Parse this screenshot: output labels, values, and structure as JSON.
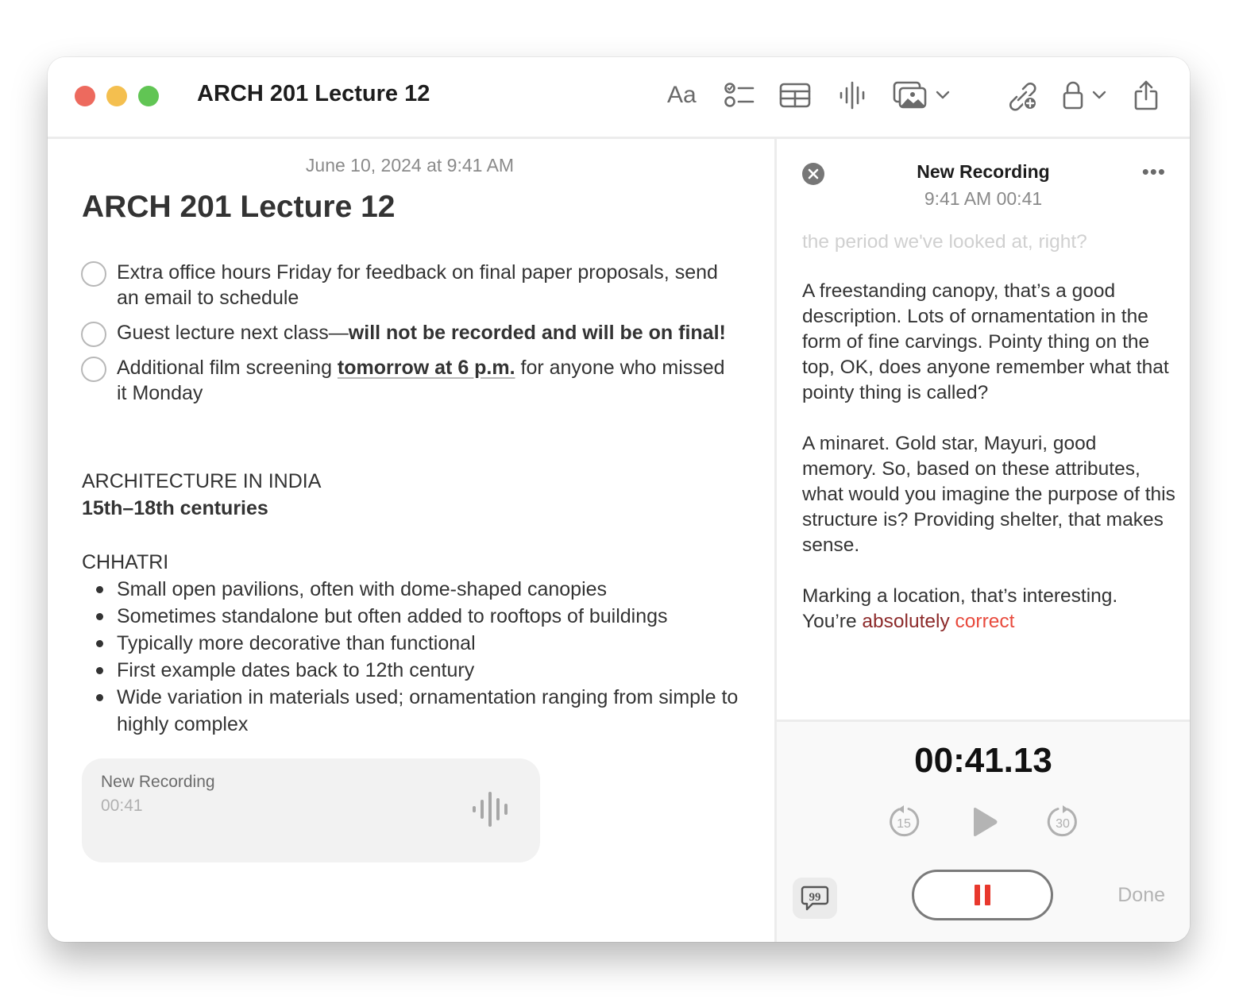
{
  "window": {
    "title": "ARCH 201 Lecture 12",
    "traffic_lights": {
      "close": "#ed6a5e",
      "minimize": "#f4bf4f",
      "zoom": "#61c554"
    }
  },
  "toolbar": {
    "format_label": "Aa",
    "icons": [
      "format-text-icon",
      "checklist-icon",
      "table-icon",
      "audio-waveform-icon",
      "media-icon",
      "chevron-down-icon",
      "collaborate-link-icon",
      "lock-icon",
      "chevron-down-icon",
      "share-icon"
    ]
  },
  "note": {
    "date": "June 10, 2024 at 9:41 AM",
    "title": "ARCH 201 Lecture 12",
    "checklist": [
      {
        "checked": false,
        "text": "Extra office hours Friday for feedback on final paper proposals, send an email to schedule"
      },
      {
        "checked": false,
        "text_plain": "Guest lecture next class—",
        "text_bold": "will not be recorded and will be on final!"
      },
      {
        "checked": false,
        "text_before": "Additional film screening ",
        "text_link": "tomorrow at 6 p.m.",
        "text_after": " for anyone who missed it Monday"
      }
    ],
    "section_heading": "ARCHITECTURE IN INDIA",
    "section_subheading": "15th–18th centuries",
    "topic": "CHHATRI",
    "bullets": [
      "Small open pavilions, often with dome-shaped canopies",
      "Sometimes standalone but often added to rooftops of buildings",
      "Typically more decorative than functional",
      "First example dates back to 12th century",
      "Wide variation in materials used; ornamentation ranging from simple to highly complex"
    ],
    "recording_card": {
      "title": "New Recording",
      "duration": "00:41"
    }
  },
  "panel": {
    "title": "New Recording",
    "subtitle": "9:41 AM 00:41",
    "more_label": "•••",
    "transcript": {
      "faded_line": "the period we've looked at, right?",
      "paragraph_1": "A freestanding canopy, that’s a good description. Lots of ornamentation in the form of fine carvings. Pointy thing on the top, OK, does anyone remember what that pointy thing is called?",
      "paragraph_2": "A minaret. Gold star, Mayuri, good memory. So, based on these attributes, what would you imagine the purpose of this structure is? Providing shelter, that makes sense.",
      "paragraph_3_plain": "Marking a location, that’s interesting. You’re ",
      "paragraph_3_hl1": "absolutely",
      "paragraph_3_hl2": "correct"
    },
    "timer": "00:41.13",
    "skip_back_label": "15",
    "skip_forward_label": "30",
    "done_label": "Done",
    "accent_color": "#e8382d"
  }
}
